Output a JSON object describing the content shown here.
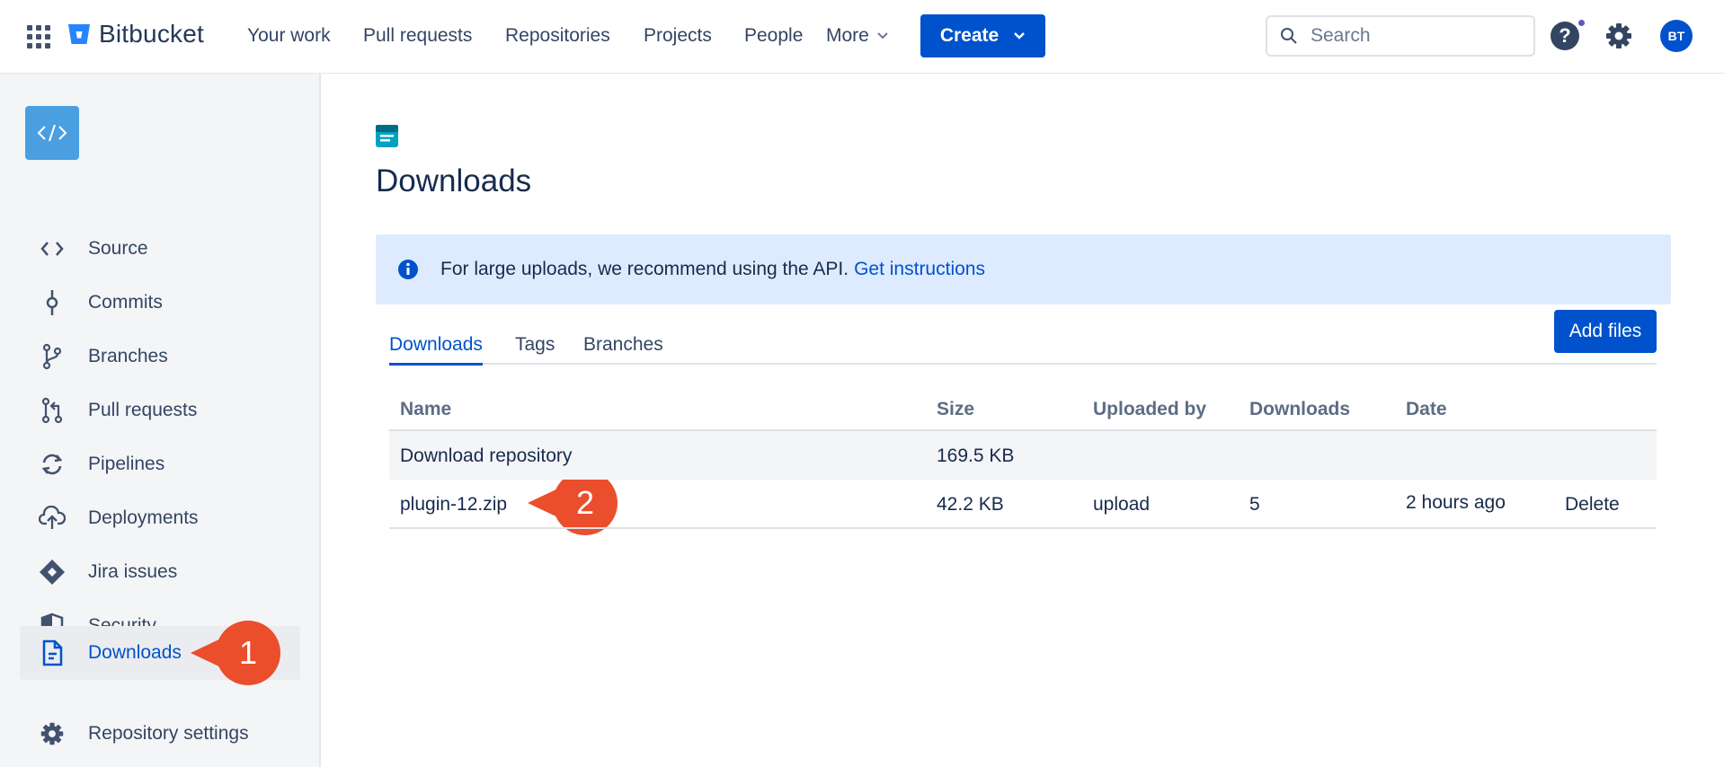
{
  "topnav": {
    "brand": "Bitbucket",
    "items": [
      "Your work",
      "Pull requests",
      "Repositories",
      "Projects",
      "People"
    ],
    "more_label": "More",
    "create_label": "Create",
    "search_placeholder": "Search",
    "avatar_initials": "BT"
  },
  "sidebar": {
    "items": [
      {
        "label": "Source",
        "icon": "source-icon"
      },
      {
        "label": "Commits",
        "icon": "commit-icon"
      },
      {
        "label": "Branches",
        "icon": "branch-icon"
      },
      {
        "label": "Pull requests",
        "icon": "pull-request-icon"
      },
      {
        "label": "Pipelines",
        "icon": "pipelines-icon"
      },
      {
        "label": "Deployments",
        "icon": "deployments-icon"
      },
      {
        "label": "Jira issues",
        "icon": "jira-icon"
      },
      {
        "label": "Security",
        "icon": "shield-icon"
      },
      {
        "label": "Downloads",
        "icon": "document-icon",
        "active": true
      },
      {
        "label": "Repository settings",
        "icon": "gear-icon"
      }
    ]
  },
  "callouts": {
    "one": "1",
    "two": "2"
  },
  "main": {
    "title": "Downloads",
    "banner_text": "For large uploads, we recommend using the API.",
    "banner_link": "Get instructions",
    "tabs": [
      "Downloads",
      "Tags",
      "Branches"
    ],
    "add_files_label": "Add files",
    "table": {
      "headers": [
        "Name",
        "Size",
        "Uploaded by",
        "Downloads",
        "Date"
      ],
      "rows": [
        {
          "name": "Download repository",
          "size": "169.5 KB",
          "uploaded_by": "",
          "downloads": "",
          "date": "",
          "action": ""
        },
        {
          "name": "plugin-12.zip",
          "size": "42.2 KB",
          "uploaded_by": "upload",
          "downloads": "5",
          "date": "2 hours ago",
          "action": "Delete"
        }
      ]
    }
  },
  "colors": {
    "accent": "#0052CC",
    "callout": "#EA4E2C",
    "banner_bg": "#DEEBFF",
    "sidebar_bg": "#F4F5F7"
  }
}
